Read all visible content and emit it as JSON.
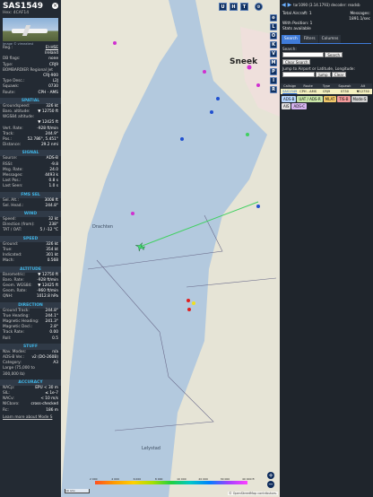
{
  "aircraft": {
    "callsign": "SAS1549",
    "hex_label": "Hex:",
    "hex": "4CAF14",
    "close_icon": "x-circle-icon",
    "photo_credit": "Image © vimeatest"
  },
  "identity": [
    {
      "k": "Reg.:",
      "v": "EI-HSE",
      "link": true
    },
    {
      "k": "",
      "v": "Ireland"
    },
    {
      "k": "DB flags:",
      "v": "none"
    },
    {
      "k": "Type:",
      "v": "CRJ9"
    },
    {
      "k": "BOMBARDIER Regional Jet",
      "v": ""
    },
    {
      "k": "",
      "v": "CRJ-900"
    },
    {
      "k": "Type Desc.:",
      "v": "L2J"
    },
    {
      "k": "Squawk:",
      "v": "0730"
    },
    {
      "k": "Route:",
      "v": "CPH - AMS"
    }
  ],
  "sections": [
    {
      "title": "SPATIAL",
      "rows": [
        {
          "k": "Groundspeed:",
          "v": "326 kt"
        },
        {
          "k": "Baro. altitude:",
          "v": "▼ 12750 ft"
        },
        {
          "k": "WGS84 altitude:",
          "v": ""
        },
        {
          "k": "",
          "v": "▼ 12425 ft"
        },
        {
          "k": "Vert. Rate:",
          "v": "-928 ft/min"
        },
        {
          "k": "Track:",
          "v": "244.9°"
        },
        {
          "k": "Pos.:",
          "v": "52.786°, 5.451°"
        },
        {
          "k": "Distance:",
          "v": "29.2 nmi"
        }
      ]
    },
    {
      "title": "SIGNAL",
      "rows": [
        {
          "k": "Source:",
          "v": "ADS-B"
        },
        {
          "k": "RSSI:",
          "v": "-9.8"
        },
        {
          "k": "Msg. Rate:",
          "v": "24.0"
        },
        {
          "k": "Messages:",
          "v": "4493 k"
        },
        {
          "k": "Last Pos.:",
          "v": "0.8 s"
        },
        {
          "k": "Last Seen:",
          "v": "1.0 s"
        }
      ]
    },
    {
      "title": "FMS SEL",
      "rows": [
        {
          "k": "Sel. Alt.:",
          "v": "3008 ft"
        },
        {
          "k": "Sel. Head.:",
          "v": "244.8°"
        }
      ]
    },
    {
      "title": "WIND",
      "rows": [
        {
          "k": "Speed:",
          "v": "32 kt"
        },
        {
          "k": "Direction (from):",
          "v": "238°"
        },
        {
          "k": "TAT / OAT:",
          "v": "5 / -12 °C"
        }
      ]
    },
    {
      "title": "SPEED",
      "rows": [
        {
          "k": "Ground:",
          "v": "326 kt"
        },
        {
          "k": "True:",
          "v": "354 kt"
        },
        {
          "k": "Indicated:",
          "v": "301 kt"
        },
        {
          "k": "Mach:",
          "v": "0.568"
        }
      ]
    },
    {
      "title": "ALTITUDE",
      "rows": [
        {
          "k": "Barometric:",
          "v": "▼ 12750 ft"
        },
        {
          "k": "Baro. Rate:",
          "v": "-928 ft/min"
        },
        {
          "k": "Geom. WGS84:",
          "v": "▼ 12425 ft"
        },
        {
          "k": "Geom. Rate:",
          "v": "-960 ft/min"
        },
        {
          "k": "QNH:",
          "v": "1012.8 hPa"
        }
      ]
    },
    {
      "title": "DIRECTION",
      "rows": [
        {
          "k": "Ground Track:",
          "v": "244.8°"
        },
        {
          "k": "True Heading:",
          "v": "244.1°"
        },
        {
          "k": "Magnetic Heading:",
          "v": "241.3°"
        },
        {
          "k": "Magnetic Decl.:",
          "v": "2.8°"
        },
        {
          "k": "Track Rate:",
          "v": "0.00"
        },
        {
          "k": "Roll:",
          "v": "0.5"
        }
      ]
    },
    {
      "title": "STUFF",
      "rows": [
        {
          "k": "Nav. Modes:",
          "v": "n/a"
        },
        {
          "k": "ADS-B Ver.:",
          "v": "v2 (DO-260B)"
        },
        {
          "k": "Category:",
          "v": "A3"
        },
        {
          "k": "Large (75,000 to",
          "v": ""
        },
        {
          "k": "300,000 lb)",
          "v": ""
        }
      ]
    },
    {
      "title": "ACCURACY",
      "rows": [
        {
          "k": "NACp:",
          "v": "EPU < 30 m"
        },
        {
          "k": "SIL:",
          "v": "≤ 1e-7"
        },
        {
          "k": "NACv:",
          "v": "< 10 m/s"
        },
        {
          "k": "NICbaro:",
          "v": "cross-checked"
        },
        {
          "k": "Rc:",
          "v": "186 m"
        }
      ]
    }
  ],
  "footer_note": "Learn more about Mode S",
  "map": {
    "side_buttons": [
      "L",
      "O",
      "K",
      "V",
      "M",
      "P",
      "I",
      "R"
    ],
    "top_buttons": [
      "U",
      "H",
      "T"
    ],
    "city_label": "Sneek",
    "area_label": "Drachten",
    "town_label": "Lelystad",
    "zoom_in": "+",
    "zoom_out": "−",
    "scale_label": "10 nmi",
    "colorbar_labels": [
      "2 000",
      "4 000",
      "6 000",
      "8 000",
      "10 000",
      "20 000",
      "30 000",
      "40 000 ft"
    ],
    "attribution": "© OpenStreetMap contributors."
  },
  "right": {
    "version_text": "tar1090 (3.14.1793) decoder: readsb",
    "stats": [
      {
        "k": "Total Aircraft: 1",
        "v": "Messages:"
      },
      {
        "k": "",
        "v": "1891.1/sec"
      },
      {
        "k": "With Position: 1",
        "v": ""
      },
      {
        "k": "Stats available",
        "v": ""
      }
    ],
    "tabs": [
      "Search",
      "Filters",
      "Columns"
    ],
    "active_tab": "Search",
    "search_label": "Search:",
    "search_button": "Search",
    "clear_search": "Clear Search",
    "jump_label": "Jump to Airport or Latitude, Longitude:",
    "jump_button": "Jump",
    "clear_button": "Clear",
    "table_headers": [
      "Callsign",
      "Route",
      "Type",
      "Squawk",
      "Alt"
    ],
    "table_row": [
      "SAS1549",
      "CPH - AMS",
      "CRJ9",
      "0730",
      "▼12750"
    ],
    "source_tags": [
      {
        "label": "ADS-B",
        "color": "#b7d7ff"
      },
      {
        "label": "UAT / ADS-R",
        "color": "#c9e6a8"
      },
      {
        "label": "MLAT",
        "color": "#f2c96a"
      },
      {
        "label": "TIS-B",
        "color": "#f19a9a"
      },
      {
        "label": "Mode-S",
        "color": "#cfcfcf"
      },
      {
        "label": "AIS",
        "color": "#e0e0e0"
      },
      {
        "label": "ADS-C",
        "color": "#d6b4f0"
      }
    ]
  }
}
